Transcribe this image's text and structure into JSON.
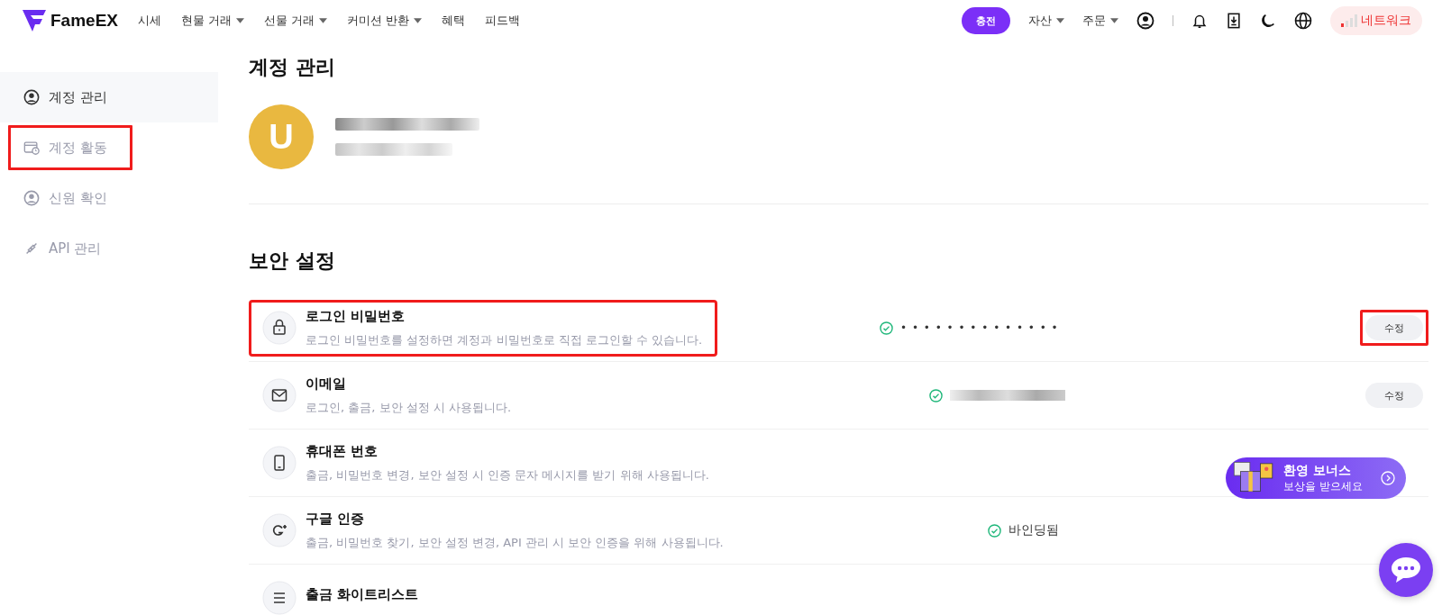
{
  "header": {
    "logo": "FameEX",
    "nav": [
      {
        "label": "시세",
        "dropdown": false
      },
      {
        "label": "현물 거래",
        "dropdown": true
      },
      {
        "label": "선물 거래",
        "dropdown": true
      },
      {
        "label": "커미션 반환",
        "dropdown": true
      },
      {
        "label": "혜택",
        "dropdown": false
      },
      {
        "label": "피드백",
        "dropdown": false
      }
    ],
    "deposit": "충전",
    "menus": [
      {
        "label": "자산",
        "dropdown": true
      },
      {
        "label": "주문",
        "dropdown": true
      }
    ],
    "network": "네트워크"
  },
  "sidebar": {
    "items": [
      {
        "label": "계정 관리",
        "kind": "user",
        "selected": true,
        "highlighted": false
      },
      {
        "label": "계정 활동",
        "kind": "activity",
        "selected": false,
        "highlighted": true
      },
      {
        "label": "신원 확인",
        "kind": "user",
        "selected": false,
        "highlighted": false
      },
      {
        "label": "API 관리",
        "kind": "plug",
        "selected": false,
        "highlighted": false
      }
    ]
  },
  "page_title": "계정 관리",
  "profile": {
    "initial": "U"
  },
  "security": {
    "title": "보안 설정",
    "rows": [
      {
        "kind": "lock",
        "title": "로그인 비밀번호",
        "description": "로그인 비밀번호를 설정하면 계정과 비밀번호로 직접 로그인할 수 있습니다.",
        "highlighted": true,
        "status": {
          "kind": "masked",
          "text": "• • • • • • • • • • • • • •"
        },
        "button": {
          "label": "수정",
          "highlighted": true
        }
      },
      {
        "kind": "mail",
        "title": "이메일",
        "description": "로그인, 출금, 보안 설정 시 사용됩니다.",
        "highlighted": false,
        "status": {
          "kind": "blurred"
        },
        "button": {
          "label": "수정",
          "highlighted": false
        }
      },
      {
        "kind": "phone",
        "title": "휴대폰 번호",
        "description": "출금, 비밀번호 변경, 보안 설정 시 인증 문자 메시지를 받기 위해 사용됩니다.",
        "highlighted": false
      },
      {
        "kind": "google",
        "title": "구글 인증",
        "description": "출금, 비밀번호 찾기, 보안 설정 변경, API 관리 시 보안 인증을 위해 사용됩니다.",
        "highlighted": false,
        "status": {
          "kind": "text",
          "text": "바인딩됨"
        }
      },
      {
        "kind": "list",
        "title": "출금 화이트리스트",
        "highlighted": false
      }
    ]
  },
  "bonus": {
    "title": "환영 보너스",
    "subtitle": "보상을 받으세요"
  }
}
